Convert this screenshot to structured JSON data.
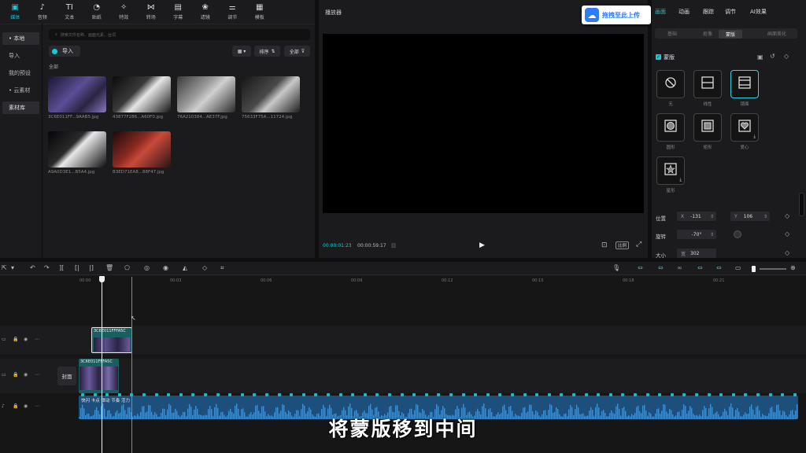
{
  "top_tabs": [
    {
      "label": "媒体",
      "icon": "media-icon",
      "glyph": "▣"
    },
    {
      "label": "音频",
      "icon": "audio-icon",
      "glyph": "♪"
    },
    {
      "label": "文本",
      "icon": "text-icon",
      "glyph": "TI"
    },
    {
      "label": "贴纸",
      "icon": "sticker-icon",
      "glyph": "◔"
    },
    {
      "label": "特效",
      "icon": "effects-icon",
      "glyph": "✧"
    },
    {
      "label": "转场",
      "icon": "transition-icon",
      "glyph": "⋈"
    },
    {
      "label": "字幕",
      "icon": "caption-icon",
      "glyph": "▤"
    },
    {
      "label": "滤镜",
      "icon": "filter-icon",
      "glyph": "❀"
    },
    {
      "label": "调节",
      "icon": "adjust-icon",
      "glyph": "⚌"
    },
    {
      "label": "模板",
      "icon": "template-icon",
      "glyph": "▦"
    }
  ],
  "left_nav": [
    "• 本地",
    "导入",
    "我的预设",
    "• 云素材",
    "素材库"
  ],
  "search_placeholder": "搜索文件名称、画面元素、台词",
  "import_label": "导入",
  "sort_label": "排序",
  "filter_label": "全部",
  "section_label": "全部",
  "media_files": [
    {
      "name": "3C6E011FF...9AAB5.jpg",
      "thumb": "purple"
    },
    {
      "name": "43877F286...A60F0.jpg",
      "thumb": "bw"
    },
    {
      "name": "76A210384...AE37F.jpg",
      "thumb": "grey"
    },
    {
      "name": "75633F75A...11724.jpg",
      "thumb": "dark"
    },
    {
      "name": "A9A0D3E1...B5A4.jpg",
      "thumb": "black"
    },
    {
      "name": "B3ED71EA8...88F47.jpg",
      "thumb": "red"
    }
  ],
  "player": {
    "title": "播放器",
    "current_time": "00:00:01:23",
    "total_time": "00:00:59:17",
    "ratio_label": "比例",
    "upload_label": "拖拽至此上传"
  },
  "inspector": {
    "tabs": [
      "画面",
      "动画",
      "跟踪",
      "调节",
      "AI效果"
    ],
    "subtabs": [
      "基础",
      "抠像",
      "蒙版",
      "画面美化"
    ],
    "mask_title": "蒙版",
    "masks": [
      {
        "label": "无",
        "icon": "no-mask-icon"
      },
      {
        "label": "线性",
        "icon": "linear-mask-icon"
      },
      {
        "label": "镜面",
        "icon": "mirror-mask-icon"
      },
      {
        "label": "圆形",
        "icon": "circle-mask-icon"
      },
      {
        "label": "矩形",
        "icon": "rect-mask-icon"
      },
      {
        "label": "爱心",
        "icon": "heart-mask-icon"
      },
      {
        "label": "星形",
        "icon": "star-mask-icon"
      }
    ],
    "position_label": "位置",
    "x_label": "X",
    "x_value": "-131",
    "y_label": "Y",
    "y_value": "106",
    "rotate_label": "旋转",
    "rotate_value": "-70°",
    "size_label": "大小",
    "size_w_label": "宽",
    "size_w_value": "302"
  },
  "timeline": {
    "ticks": [
      "00:00",
      "00:03",
      "00:06",
      "00:09",
      "00:12",
      "00:15",
      "00:18",
      "00:21"
    ],
    "clip_upper": "3C6E011FFFA5C",
    "clip_main": "3C6E011FFFA5C",
    "cover_label": "封面",
    "audio_label": "快闪 卡点 律动 节奏 活力"
  },
  "subtitle": "将蒙版移到中间",
  "colors": {
    "accent": "#1ec7d4",
    "clip": "#1b5e5f",
    "audio": "#1c4f7c"
  }
}
